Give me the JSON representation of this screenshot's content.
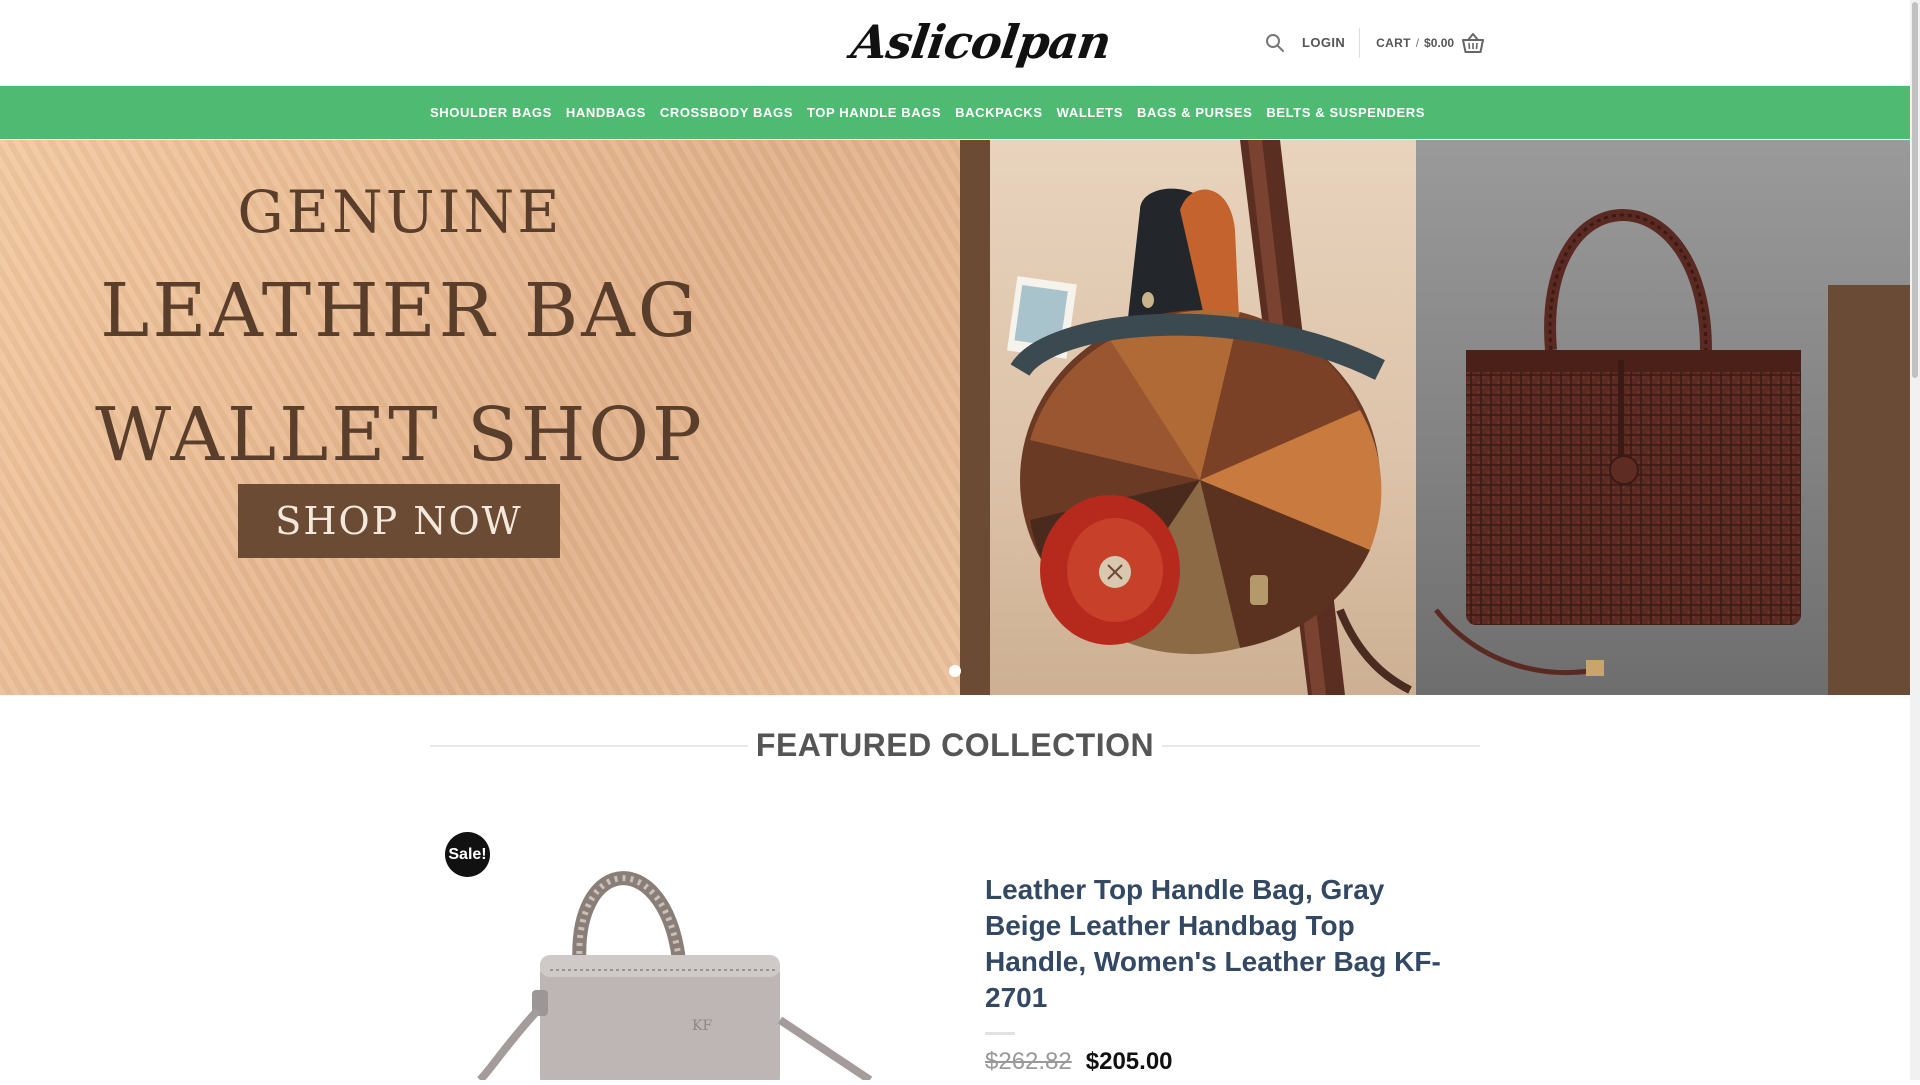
{
  "header": {
    "logo_text": "Aslicolpan",
    "login_label": "LOGIN",
    "cart_label": "CART",
    "cart_separator": "/",
    "cart_amount": "$0.00",
    "icons": [
      "search-icon",
      "basket-icon"
    ]
  },
  "nav": {
    "items": [
      {
        "label": "SHOULDER BAGS"
      },
      {
        "label": "HANDBAGS"
      },
      {
        "label": "CROSSBODY BAGS"
      },
      {
        "label": "TOP HANDLE BAGS"
      },
      {
        "label": "BACKPACKS"
      },
      {
        "label": "WALLETS"
      },
      {
        "label": "BAGS & PURSES"
      },
      {
        "label": "BELTS & SUSPENDERS"
      }
    ],
    "bar_color": "#4fbb72"
  },
  "hero": {
    "line1": "GENUINE",
    "line2": "LEATHER BAG",
    "line3": "WALLET SHOP",
    "cta_label": "SHOP NOW",
    "active_slide": 1,
    "slide_count": 1
  },
  "featured": {
    "title": "FEATURED COLLECTION"
  },
  "product": {
    "sale_badge": "Sale!",
    "title": "Leather Top Handle Bag, Gray Beige Leather Handbag Top Handle, Women's Leather Bag KF-2701",
    "old_price": "$262.82",
    "new_price": "$205.00"
  },
  "colors": {
    "title_link": "#334862",
    "accent_green": "#4fbb72"
  }
}
